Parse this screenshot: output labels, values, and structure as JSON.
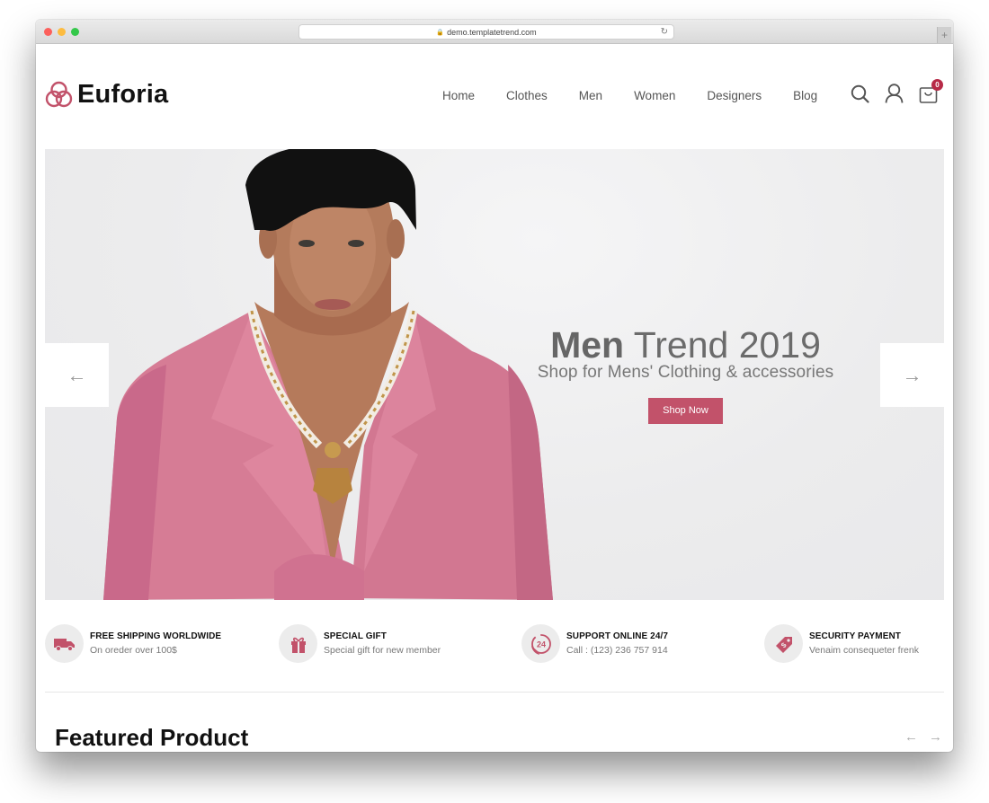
{
  "browser": {
    "url": "demo.templatetrend.com",
    "lock_icon": "lock-icon",
    "reload_icon": "reload-icon",
    "new_tab_label": "+"
  },
  "header": {
    "brand": "Euforia",
    "logo_icon": "three-rings-logo-icon",
    "nav": [
      {
        "label": "Home"
      },
      {
        "label": "Clothes"
      },
      {
        "label": "Men"
      },
      {
        "label": "Women"
      },
      {
        "label": "Designers"
      },
      {
        "label": "Blog"
      }
    ],
    "icons": [
      "search-icon",
      "user-icon",
      "shopping-bag-icon"
    ],
    "cart_count": "0"
  },
  "hero": {
    "title_bold": "Men",
    "title_rest": " Trend 2019",
    "subtitle": "Shop for Mens' Clothing & accessories",
    "button_label": "Shop Now",
    "prev_arrow": "←",
    "next_arrow": "→"
  },
  "features": [
    {
      "icon": "delivery-truck-icon",
      "title": "FREE SHIPPING WORLDWIDE",
      "subtitle": "On oreder over 100$"
    },
    {
      "icon": "gift-icon",
      "title": "SPECIAL GIFT",
      "subtitle": "Special gift for new member"
    },
    {
      "icon": "support-24-icon",
      "title": "SUPPORT ONLINE 24/7",
      "subtitle": "Call : (123) 236 757 914"
    },
    {
      "icon": "price-tag-icon",
      "title": "SECURITY PAYMENT",
      "subtitle": "Venaim consequeter frenk"
    }
  ],
  "featured": {
    "title": "Featured Product",
    "prev_arrow": "←",
    "next_arrow": "→"
  },
  "colors": {
    "accent": "#c2526a",
    "badge": "#b72a47",
    "text_dark": "#111111",
    "text_muted": "#777777",
    "jacket_pink": "#d67c95"
  }
}
